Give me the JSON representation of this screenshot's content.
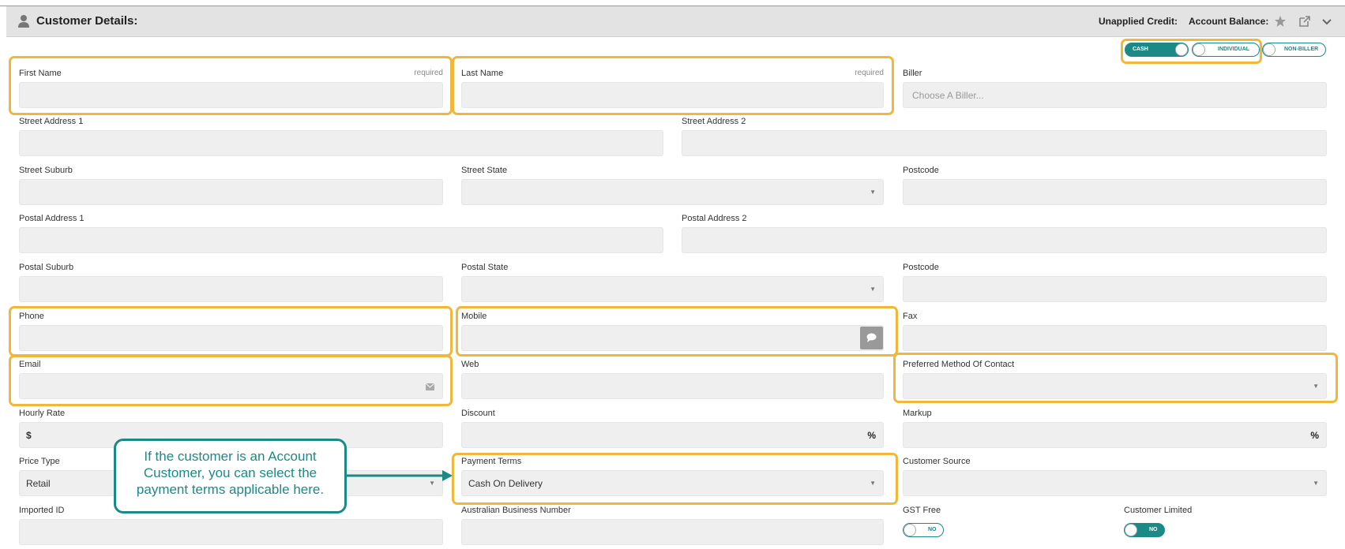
{
  "header": {
    "title": "Customer Details:",
    "unapplied_credit": "Unapplied Credit:",
    "account_balance": "Account Balance:"
  },
  "toggles": {
    "cash": "CASH",
    "individual": "INDIVIDUAL",
    "non_biller": "NON-BILLER"
  },
  "fields": {
    "first_name": {
      "label": "First Name",
      "required": "required",
      "value": ""
    },
    "last_name": {
      "label": "Last Name",
      "required": "required",
      "value": ""
    },
    "biller": {
      "label": "Biller",
      "placeholder": "Choose A Biller..."
    },
    "street1": {
      "label": "Street Address 1"
    },
    "street2": {
      "label": "Street Address 2"
    },
    "street_suburb": {
      "label": "Street Suburb"
    },
    "street_state": {
      "label": "Street State"
    },
    "street_postcode": {
      "label": "Postcode"
    },
    "postal1": {
      "label": "Postal Address 1"
    },
    "postal2": {
      "label": "Postal Address 2"
    },
    "postal_suburb": {
      "label": "Postal Suburb"
    },
    "postal_state": {
      "label": "Postal State"
    },
    "postal_postcode": {
      "label": "Postcode"
    },
    "phone": {
      "label": "Phone"
    },
    "mobile": {
      "label": "Mobile"
    },
    "fax": {
      "label": "Fax"
    },
    "email": {
      "label": "Email"
    },
    "web": {
      "label": "Web"
    },
    "preferred_contact": {
      "label": "Preferred Method Of Contact"
    },
    "hourly_rate": {
      "label": "Hourly Rate",
      "prefix": "$"
    },
    "discount": {
      "label": "Discount",
      "suffix": "%"
    },
    "markup": {
      "label": "Markup",
      "suffix": "%"
    },
    "price_type": {
      "label": "Price Type",
      "value": "Retail"
    },
    "payment_terms": {
      "label": "Payment Terms",
      "value": "Cash On Delivery"
    },
    "customer_source": {
      "label": "Customer Source"
    },
    "imported_id": {
      "label": "Imported ID"
    },
    "abn": {
      "label": "Australian Business Number"
    },
    "gst_free": {
      "label": "GST Free",
      "toggle": "NO"
    },
    "customer_limited": {
      "label": "Customer Limited",
      "toggle": "NO"
    }
  },
  "callout": {
    "text": "If the customer is an Account Customer, you can select the payment terms applicable here."
  },
  "colors": {
    "highlight": "#f0b73a",
    "teal": "#1b8a86",
    "field_bg": "#efefef",
    "header_bg": "#e3e3e3"
  },
  "icons": {
    "user": "user-icon",
    "star": "star-icon",
    "external": "external-link-icon",
    "chevron": "chevron-down-icon",
    "message": "message-icon",
    "envelope": "envelope-icon"
  }
}
